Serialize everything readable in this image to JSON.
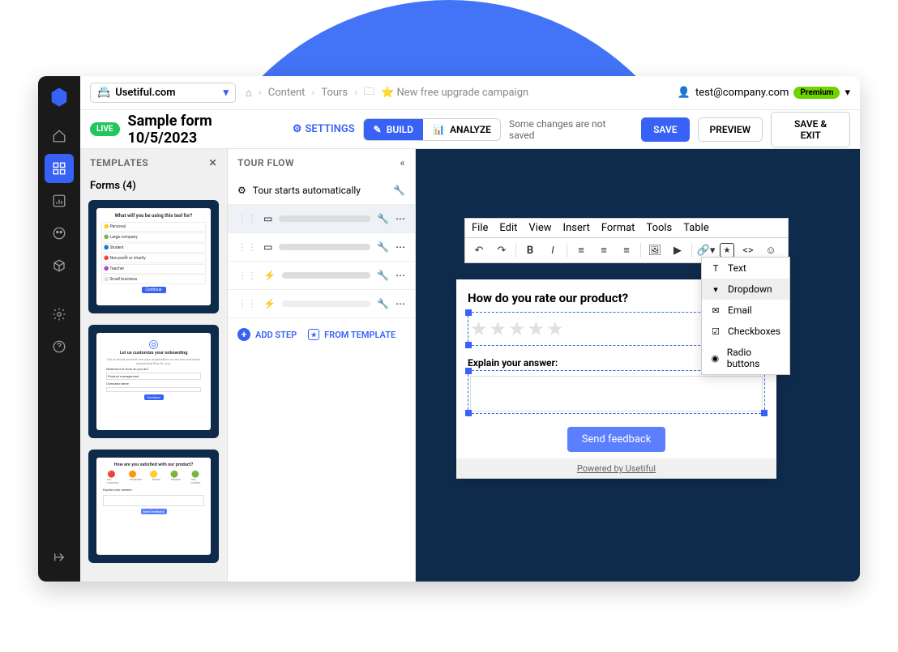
{
  "site": "Usetiful.com",
  "breadcrumbs": {
    "content": "Content",
    "tours": "Tours",
    "campaign": "⭐ New free upgrade campaign"
  },
  "user_email": "test@company.com",
  "premium_badge": "Premium",
  "live_badge": "LIVE",
  "page_title": "Sample form 10/5/2023",
  "settings_label": "SETTINGS",
  "segments": {
    "build": "BUILD",
    "analyze": "ANALYZE"
  },
  "status": "Some changes are not saved",
  "buttons": {
    "save": "SAVE",
    "preview": "PREVIEW",
    "save_exit": "SAVE & EXIT"
  },
  "templates_header": "TEMPLATES",
  "templates_sub": "Forms (4)",
  "flow_header": "TOUR FLOW",
  "flow_start": "Tour starts automatically",
  "flow_actions": {
    "add_step": "ADD STEP",
    "from_template": "FROM TEMPLATE"
  },
  "editor_menu": [
    "File",
    "Edit",
    "View",
    "Insert",
    "Format",
    "Tools",
    "Table"
  ],
  "form": {
    "q1": "How do you rate our product?",
    "q2": "Explain your answer:",
    "send": "Send feedback",
    "powered": "Powered by Usetiful"
  },
  "field_menu": {
    "text": "Text",
    "dropdown": "Dropdown",
    "email": "Email",
    "checkboxes": "Checkboxes",
    "radio": "Radio buttons"
  },
  "template_previews": {
    "t1_title": "What will you be using this tool for?",
    "t1_items": [
      "Personal",
      "Large company",
      "Student",
      "Non-profit or charity",
      "Teacher",
      "Small business"
    ],
    "t2_title": "Let us customize your onboarding",
    "t3_title": "How are you satisfied with our product?",
    "t3_labels": [
      "Very unsatisfied",
      "Unsatisfied",
      "Neutral",
      "Satisfied",
      "Very satisfied"
    ]
  }
}
